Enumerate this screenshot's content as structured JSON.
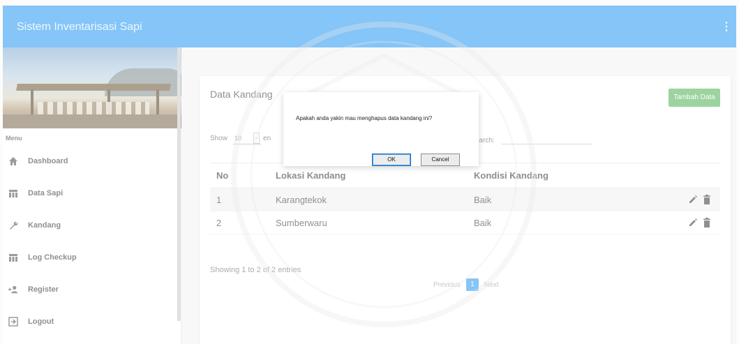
{
  "header": {
    "title": "Sistem Inventarisasi Sapi"
  },
  "sidebar": {
    "menu_label": "Menu",
    "items": [
      {
        "label": "Dashboard",
        "icon": "home-icon"
      },
      {
        "label": "Data Sapi",
        "icon": "table-icon"
      },
      {
        "label": "Kandang",
        "icon": "wrench-icon"
      },
      {
        "label": "Log Checkup",
        "icon": "table-icon"
      },
      {
        "label": "Register",
        "icon": "person-add-icon"
      },
      {
        "label": "Logout",
        "icon": "exit-icon"
      }
    ]
  },
  "card": {
    "title": "Data Kandang",
    "add_button": "Tambah Data",
    "show_label": "Show",
    "show_value": "10",
    "entries_label": "en",
    "search_label": "earch:",
    "columns": [
      "No",
      "Lokasi Kandang",
      "Kondisi Kandang"
    ],
    "rows": [
      {
        "no": "1",
        "lokasi": "Karangtekok",
        "kondisi": "Baik"
      },
      {
        "no": "2",
        "lokasi": "Sumberwaru",
        "kondisi": "Baik"
      }
    ],
    "showing": "Showing 1 to 2 of 2 entries",
    "pager": {
      "prev": "Previous",
      "page": "1",
      "next": "Next"
    }
  },
  "dialog": {
    "message": "Apakah anda yakin mau menghapus data kandang ini?",
    "ok": "OK",
    "cancel": "Cancel"
  },
  "colors": {
    "primary": "#2196F3",
    "success": "#4CAF50"
  }
}
